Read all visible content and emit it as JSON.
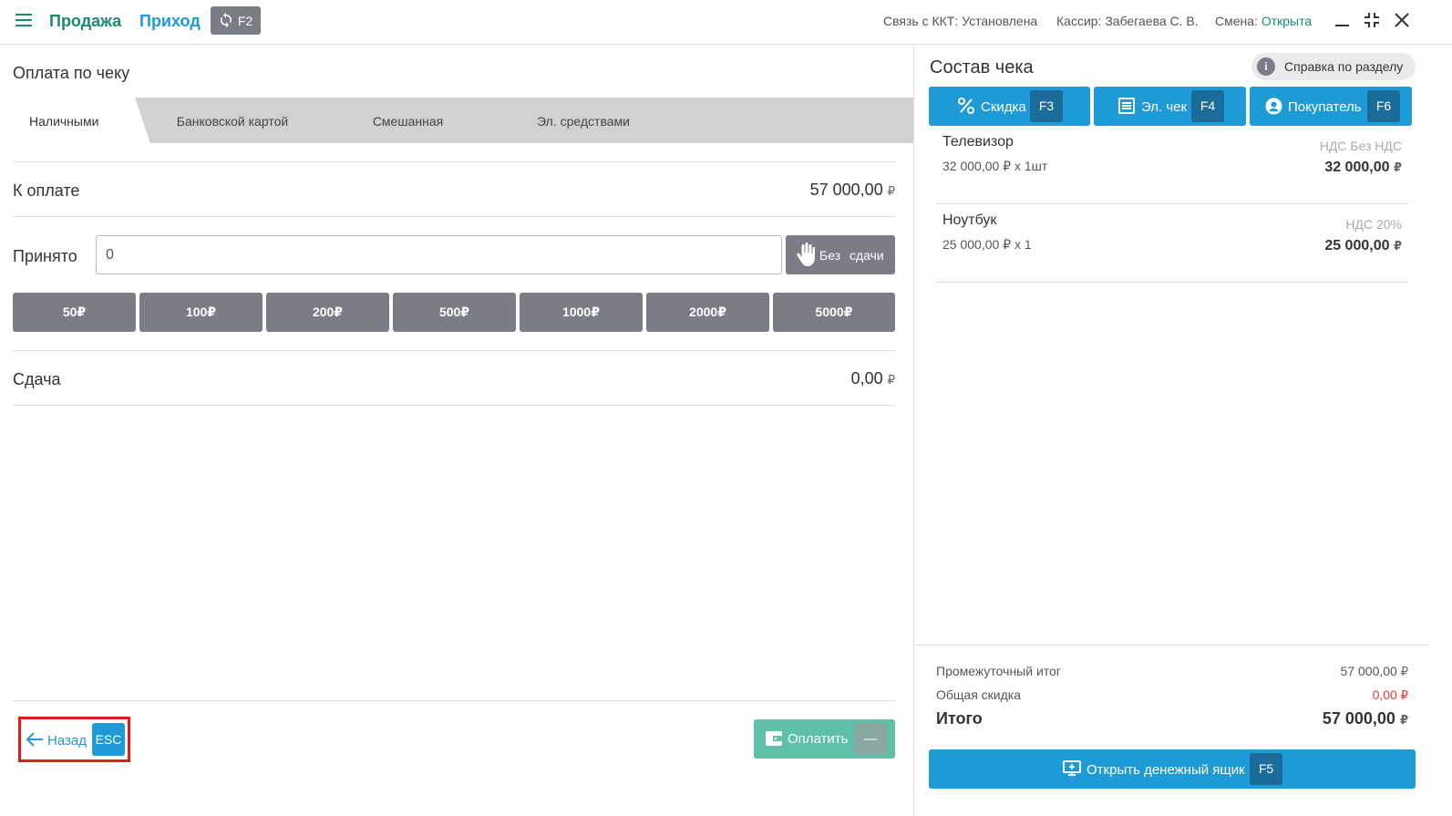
{
  "header": {
    "sale_label": "Продажа",
    "income_label": "Приход",
    "switch_key": "F2",
    "kkt_status": "Связь с ККТ: Установлена",
    "cashier": "Кассир: Забегаева С. В.",
    "shift_label": "Смена:",
    "shift_value": "Открыта"
  },
  "payment": {
    "title": "Оплата по чеку",
    "tabs": [
      {
        "label": "Наличными",
        "active": true
      },
      {
        "label": "Банковской картой",
        "active": false
      },
      {
        "label": "Смешанная",
        "active": false
      },
      {
        "label": "Эл. средствами",
        "active": false
      }
    ],
    "due_label": "К оплате",
    "due_value": "57 000,00",
    "accepted_label": "Принято",
    "accepted_value": "0",
    "no_change_label": "Без сдачи",
    "bills": [
      "50₽",
      "100₽",
      "200₽",
      "500₽",
      "1000₽",
      "2000₽",
      "5000₽"
    ],
    "change_label": "Сдача",
    "change_value": "0,00",
    "currency": "₽",
    "back_label": "Назад",
    "back_key": "ESC",
    "pay_label": "Оплатить",
    "pay_key": "—"
  },
  "receipt": {
    "title": "Состав чека",
    "help_label": "Справка по разделу",
    "discount_label": "Скидка",
    "discount_key": "F3",
    "echeck_label": "Эл. чек",
    "echeck_key": "F4",
    "customer_label": "Покупатель",
    "customer_key": "F6",
    "items": [
      {
        "name": "Телевизор",
        "qty": "32 000,00 ₽ x 1шт",
        "vat": "НДС Без НДС",
        "amount": "32 000,00"
      },
      {
        "name": "Ноутбук",
        "qty": "25 000,00 ₽ x 1",
        "vat": "НДС 20%",
        "amount": "25 000,00"
      }
    ],
    "subtotal_label": "Промежуточный итог",
    "subtotal_value": "57 000,00",
    "discount_total_label": "Общая скидка",
    "discount_total_value": "0,00",
    "total_label": "Итого",
    "total_value": "57 000,00",
    "drawer_label": "Открыть денежный ящик",
    "drawer_key": "F5"
  },
  "colors": {
    "primary": "#1e9ad6",
    "green": "#1a8a72",
    "gray_button": "#7a7d85",
    "pay_button": "#5fbfa8",
    "discount_red": "#e53935",
    "highlight_red": "#e21b1b"
  }
}
